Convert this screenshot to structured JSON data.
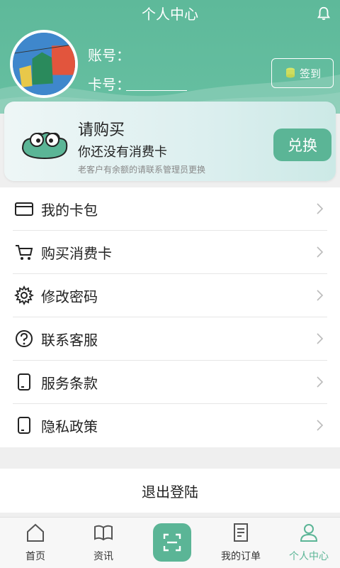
{
  "header": {
    "title": "个人中心",
    "account_label": "账号：",
    "card_label": "卡号：",
    "checkin_label": "签到"
  },
  "card": {
    "title": "请购买",
    "subtitle": "你还没有消费卡",
    "note": "老客户有余额的请联系管理员更换",
    "redeem_label": "兑换"
  },
  "menu": [
    {
      "label": "我的卡包",
      "icon": "wallet-icon"
    },
    {
      "label": "购买消费卡",
      "icon": "cart-icon"
    },
    {
      "label": "修改密码",
      "icon": "gear-icon"
    },
    {
      "label": "联系客服",
      "icon": "help-icon"
    },
    {
      "label": "服务条款",
      "icon": "document-icon"
    },
    {
      "label": "隐私政策",
      "icon": "document-icon"
    }
  ],
  "logout_label": "退出登陆",
  "tabs": [
    {
      "label": "首页",
      "icon": "home-icon"
    },
    {
      "label": "资讯",
      "icon": "book-icon"
    },
    {
      "label": "",
      "icon": "scan-icon"
    },
    {
      "label": "我的订单",
      "icon": "order-icon"
    },
    {
      "label": "个人中心",
      "icon": "user-icon",
      "active": true
    }
  ],
  "colors": {
    "accent": "#5bb596",
    "header": "#5eb99a"
  }
}
